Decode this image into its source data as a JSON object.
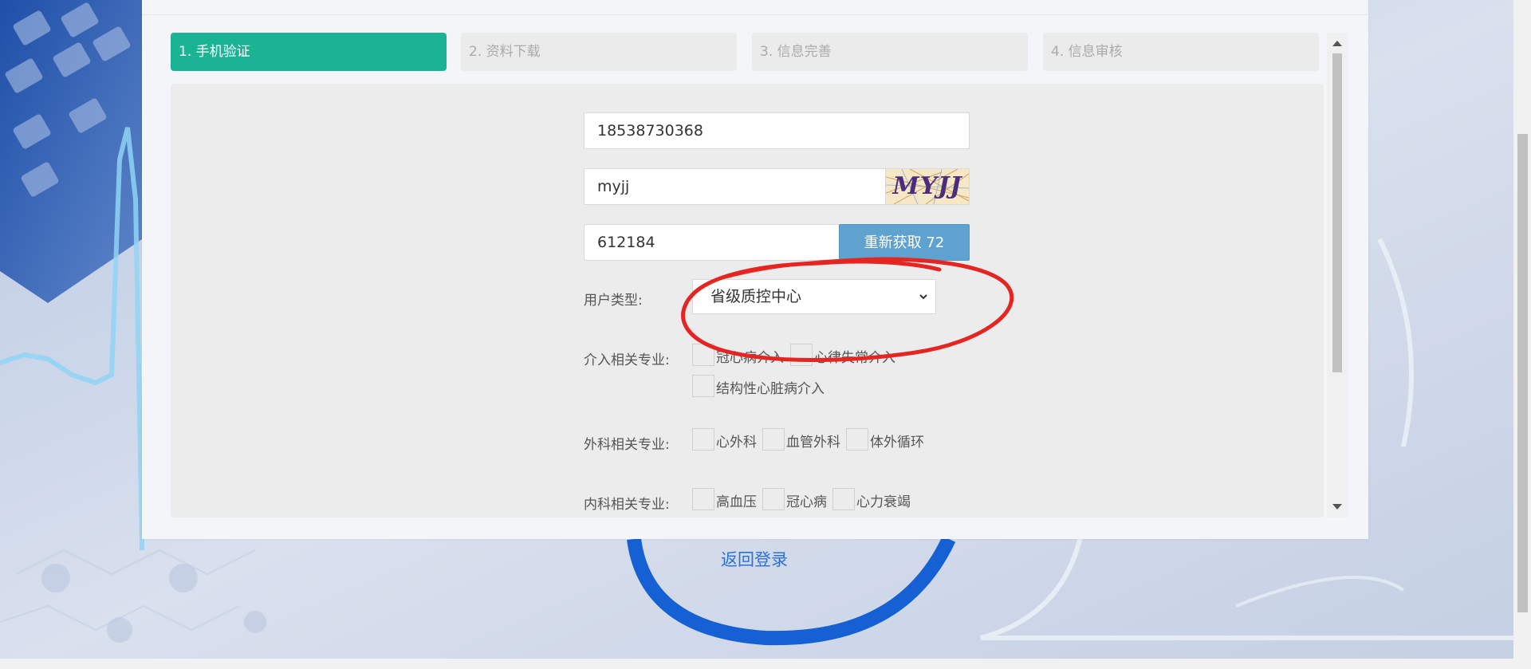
{
  "steps": [
    {
      "label": "1. 手机验证",
      "active": true
    },
    {
      "label": "2. 资料下载",
      "active": false
    },
    {
      "label": "3. 信息完善",
      "active": false
    },
    {
      "label": "4. 信息审核",
      "active": false
    }
  ],
  "form": {
    "phone_value": "18538730368",
    "captcha_value": "myjj",
    "captcha_image_text": "MYJJ",
    "sms_code_value": "612184",
    "resend_button": "重新获取 72",
    "user_type_label": "用户类型:",
    "user_type_selected": "省级质控中心",
    "intervention_label": "介入相关专业:",
    "intervention_options": [
      "冠心病介入",
      "心律失常介入",
      "结构性心脏病介入"
    ],
    "surgery_label": "外科相关专业:",
    "surgery_options": [
      "心外科",
      "血管外科",
      "体外循环"
    ],
    "internal_label": "内科相关专业:",
    "internal_options": [
      "高血压",
      "冠心病",
      "心力衰竭"
    ]
  },
  "back_link": "返回登录",
  "colors": {
    "active_step": "#1ab394",
    "resend_button": "#5fa2cf",
    "link": "#2b72d6",
    "annotation": "#e52521"
  }
}
